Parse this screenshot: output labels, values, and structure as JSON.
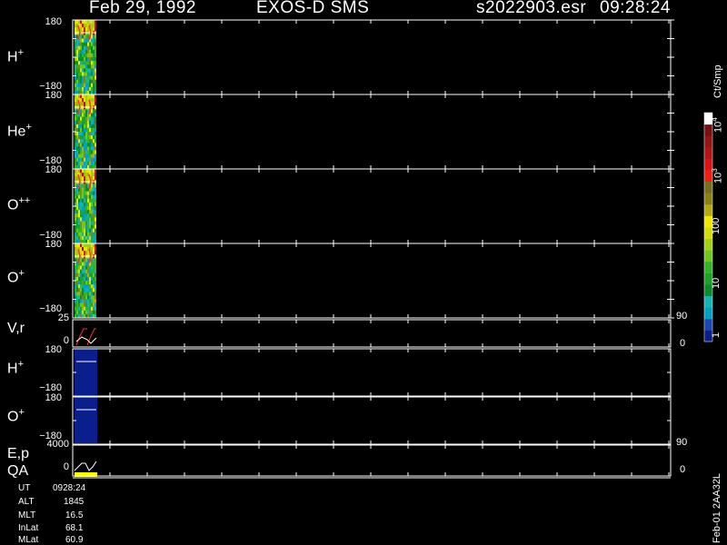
{
  "header": {
    "date": "Feb 29, 1992",
    "instrument": "EXOS-D SMS",
    "file": "s2022903.esr",
    "time": "09:28:24"
  },
  "colors": {
    "background": "#000000",
    "axes": "#ffffff",
    "scale": [
      "#0a1e8c",
      "#1c46b4",
      "#00a0c8",
      "#14b4b4",
      "#0a8c2a",
      "#1ea02a",
      "#32b428",
      "#6ec81e",
      "#a0d214",
      "#d2dc0a",
      "#f0e600",
      "#b4aa14",
      "#8c8214",
      "#786e1e",
      "#f01e14",
      "#dc1414",
      "#b41414",
      "#961414",
      "#7a1010",
      "#ffffff"
    ],
    "trace_red": "#ff3030",
    "trace_white": "#ffffff",
    "qa_yellow": "#ffff00",
    "fill_navy": "#0a1e8c"
  },
  "chart_data": {
    "type": "heatmap",
    "panels": [
      {
        "name": "H+",
        "label_main": "H",
        "label_sup": "+",
        "y_max": "180",
        "y_min": "−180",
        "ylim": [
          -180,
          180
        ]
      },
      {
        "name": "He+",
        "label_main": "He",
        "label_sup": "+",
        "y_max": "180",
        "y_min": "−180",
        "ylim": [
          -180,
          180
        ]
      },
      {
        "name": "O++",
        "label_main": "O",
        "label_sup": "++",
        "y_max": "180",
        "y_min": "−180",
        "ylim": [
          -180,
          180
        ]
      },
      {
        "name": "O+",
        "label_main": "O",
        "label_sup": "+",
        "y_max": "180",
        "y_min": "−180",
        "ylim": [
          -180,
          180
        ]
      }
    ],
    "vr_panel": {
      "label": "V,r",
      "y_max": "25",
      "y_min": "0",
      "right_max": "90",
      "right_min": "0"
    },
    "h_panel": {
      "label_main": "H",
      "label_sup": "+",
      "y_max": "180",
      "y_min": "−180"
    },
    "o_panel": {
      "label_main": "O",
      "label_sup": "+",
      "y_max": "180",
      "y_min": "−180"
    },
    "ep_panel": {
      "label": "E,p",
      "y_max": "4000",
      "y_min": "0",
      "right_max": "90",
      "right_min": "0"
    },
    "qa_label": "QA",
    "colorbar": {
      "unit": "Ct/Smp",
      "tick_labels": [
        "1",
        "10",
        "100",
        "10",
        "10"
      ],
      "tick_exponents": [
        "",
        "",
        "",
        "3",
        "4"
      ],
      "scale": "log",
      "range": [
        1,
        10000
      ]
    }
  },
  "info": [
    {
      "label": "UT",
      "value": "0928:24"
    },
    {
      "label": "ALT",
      "value": "1845"
    },
    {
      "label": "MLT",
      "value": "16.5"
    },
    {
      "label": "InLat",
      "value": "68.1"
    },
    {
      "label": "MLat",
      "value": "60.9"
    }
  ],
  "footer_id": "Feb-01 2AA32L"
}
